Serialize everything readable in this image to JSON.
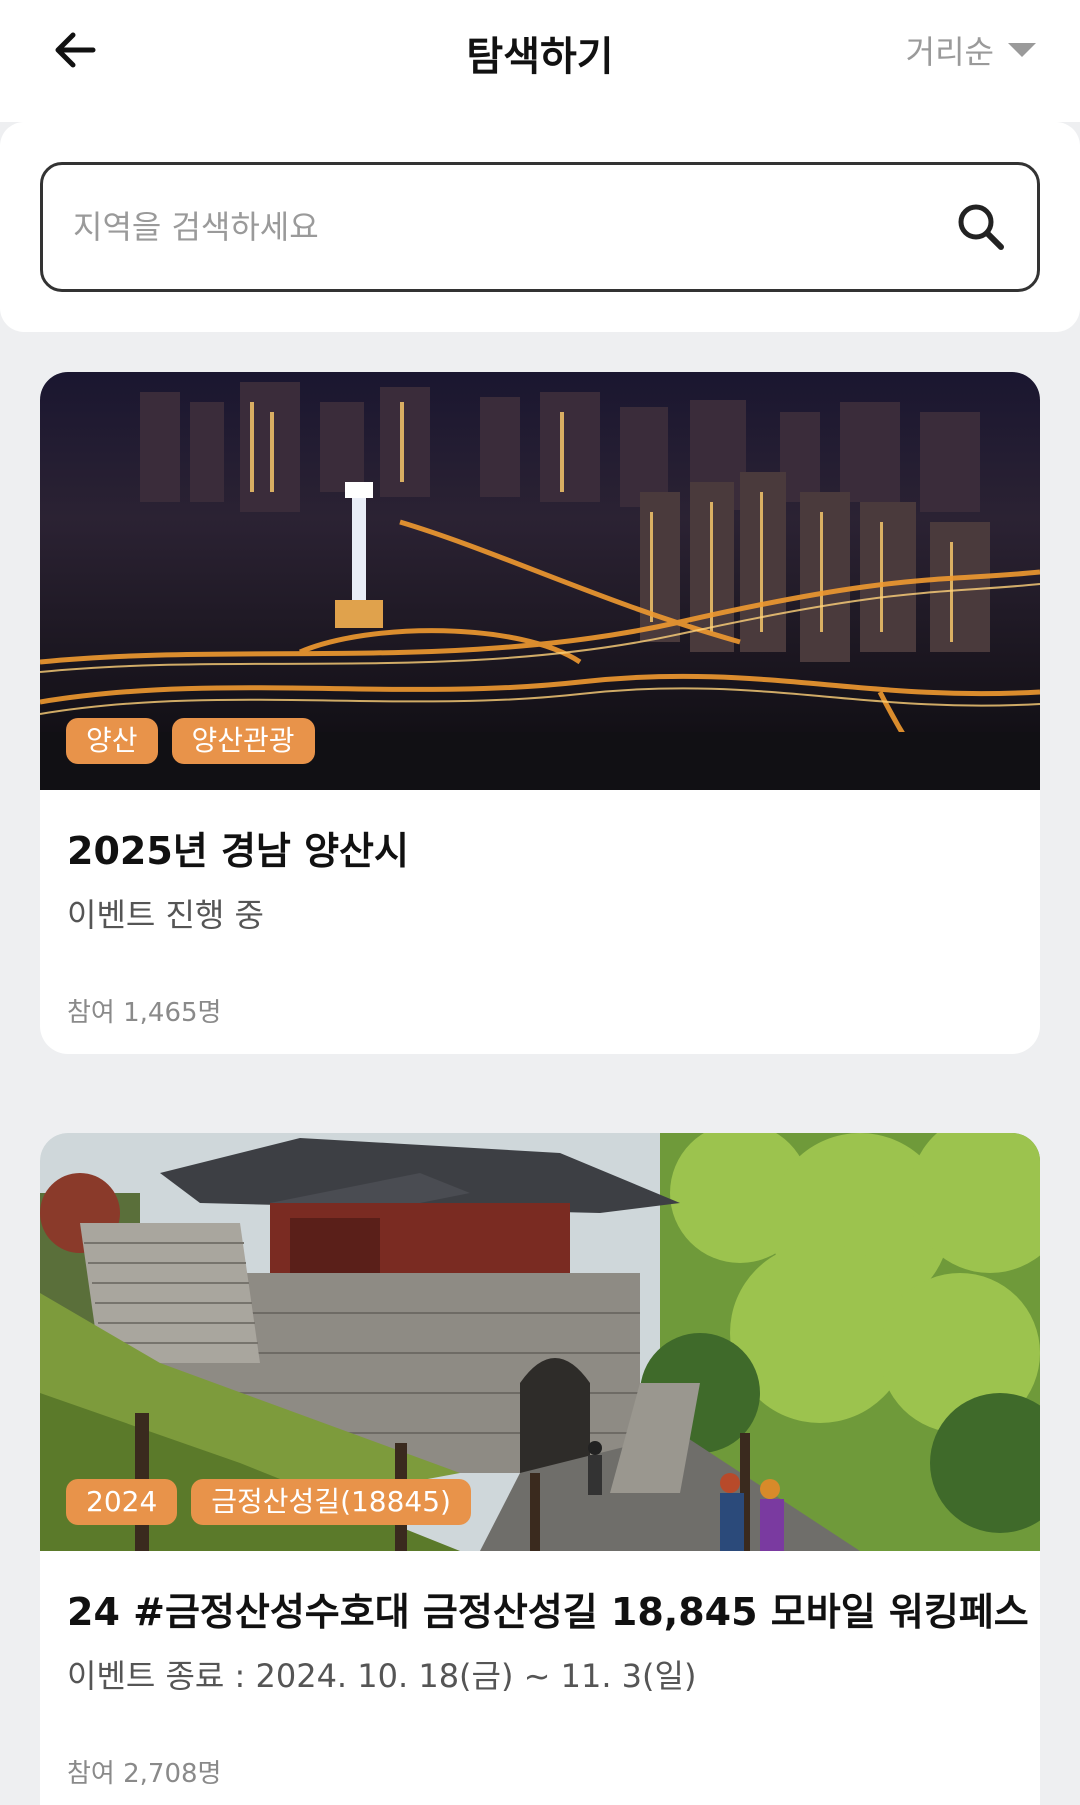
{
  "header": {
    "back_icon": "arrow-left-icon",
    "title": "탐색하기",
    "sort_label": "거리순",
    "sort_icon": "caret-down-icon"
  },
  "search": {
    "placeholder": "지역을 검색하세요",
    "icon": "search-icon"
  },
  "colors": {
    "tag_bg": "#e8934a",
    "page_bg": "#eeeff1"
  },
  "cards": [
    {
      "image": "night-city-skyline",
      "tags": [
        "양산",
        "양산관광"
      ],
      "title": "2025년 경남 양산시",
      "status": "이벤트 진행 중",
      "participants": "참여 1,465명"
    },
    {
      "image": "fortress-gate-path",
      "tags": [
        "2024",
        "금정산성길(18845)"
      ],
      "title": "24 #금정산성수호대 금정산성길 18,845 모바일 워킹페스",
      "status": "이벤트 종료 : 2024. 10. 18(금) ~ 11. 3(일)",
      "participants": "참여 2,708명"
    }
  ]
}
